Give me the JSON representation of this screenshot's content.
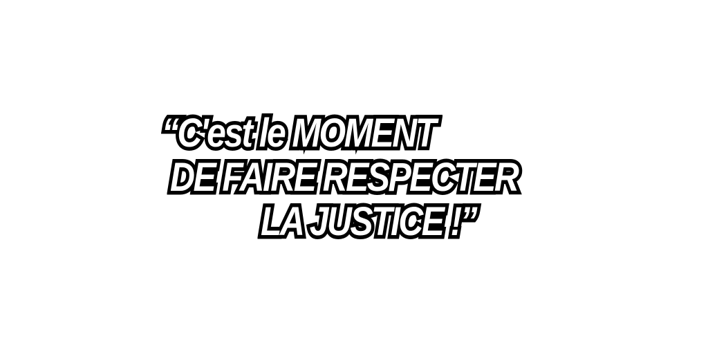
{
  "quote": {
    "line1": "“C'est le MOMENT",
    "line2": "DE FAIRE RESPECTER",
    "line3": "LA JUSTICE !”"
  }
}
